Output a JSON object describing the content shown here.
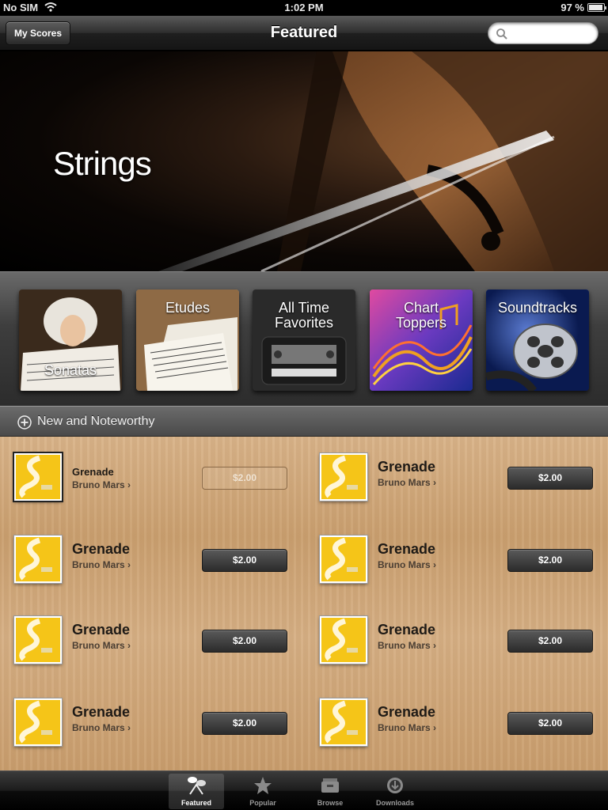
{
  "status_bar": {
    "carrier": "No SIM",
    "time": "1:02 PM",
    "battery": "97 %",
    "battery_level": 0.97
  },
  "nav": {
    "back_label": "My Scores",
    "title": "Featured",
    "search_placeholder": ""
  },
  "hero": {
    "title": "Strings"
  },
  "categories": [
    {
      "label": "Sonatas"
    },
    {
      "label": "Etudes"
    },
    {
      "label": "All Time Favorites"
    },
    {
      "label": "Chart Toppers"
    },
    {
      "label": "Soundtracks"
    }
  ],
  "section": {
    "title": "New and Noteworthy"
  },
  "items": [
    {
      "title": "Grenade",
      "artist": "Bruno Mars",
      "price": "$2.00"
    },
    {
      "title": "Grenade",
      "artist": "Bruno Mars",
      "price": "$2.00"
    },
    {
      "title": "Grenade",
      "artist": "Bruno Mars",
      "price": "$2.00"
    },
    {
      "title": "Grenade",
      "artist": "Bruno Mars",
      "price": "$2.00"
    },
    {
      "title": "Grenade",
      "artist": "Bruno Mars",
      "price": "$2.00"
    },
    {
      "title": "Grenade",
      "artist": "Bruno Mars",
      "price": "$2.00"
    },
    {
      "title": "Grenade",
      "artist": "Bruno Mars",
      "price": "$2.00"
    },
    {
      "title": "Grenade",
      "artist": "Bruno Mars",
      "price": "$2.00"
    }
  ],
  "tabs": [
    {
      "label": "Featured",
      "icon": "featured-icon",
      "active": true
    },
    {
      "label": "Popular",
      "icon": "star-icon",
      "active": false
    },
    {
      "label": "Browse",
      "icon": "browse-icon",
      "active": false
    },
    {
      "label": "Downloads",
      "icon": "download-icon",
      "active": false
    }
  ],
  "colors": {
    "accent_yellow": "#f5c518",
    "wood": "#d2aa7c",
    "bar_dark": "#1f1f1f"
  }
}
